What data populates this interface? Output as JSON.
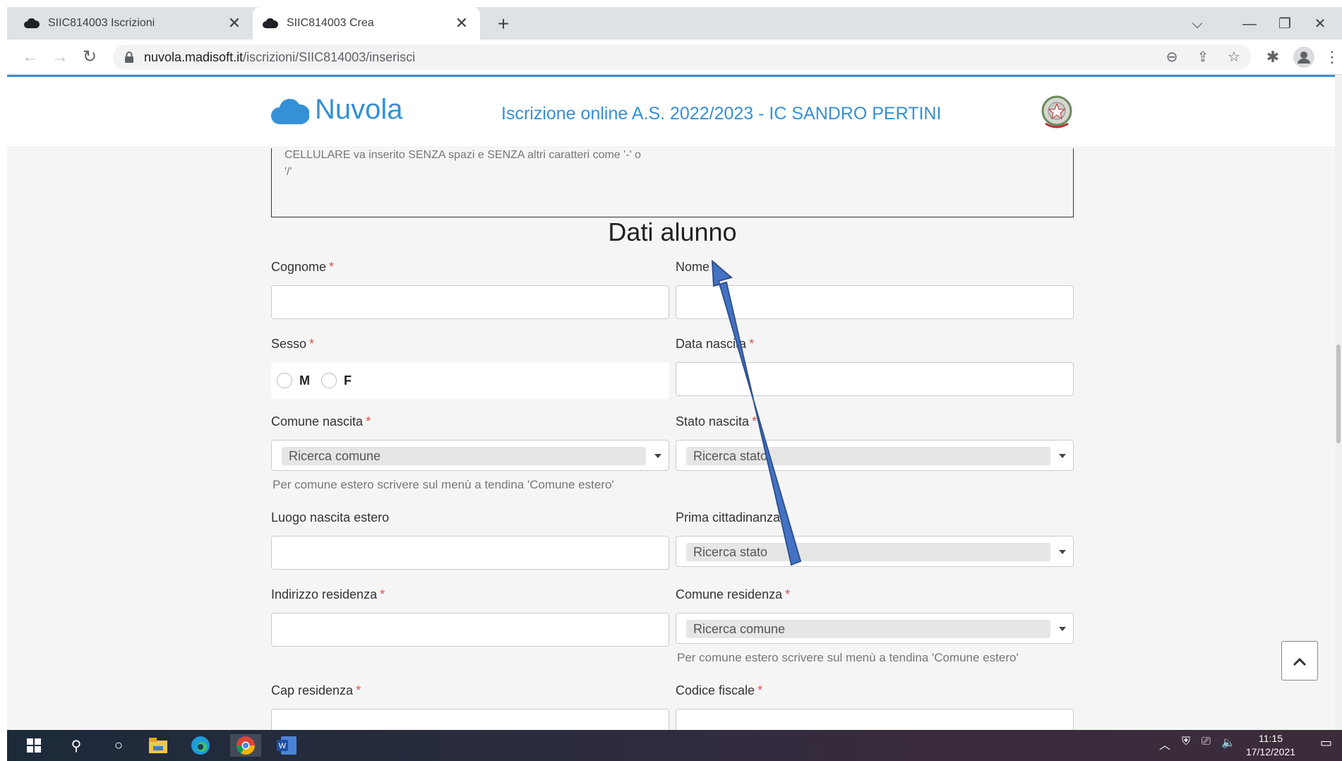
{
  "browser": {
    "tabs": [
      {
        "title": "SIIC814003 Iscrizioni",
        "close": "✕"
      },
      {
        "title": "SIIC814003 Crea",
        "close": "✕"
      }
    ],
    "new_tab": "+",
    "window_controls": {
      "dropdown": "⌵",
      "minimize": "—",
      "restore": "❐",
      "close": "✕"
    },
    "url_host": "nuvola.madisoft.it",
    "url_path": "/iscrizioni/SIIC814003/inserisci"
  },
  "site": {
    "logo_text": "Nuvola",
    "header_title": "Iscrizione online A.S. 2022/2023 - IC SANDRO PERTINI"
  },
  "notice": {
    "line1": "CELLULARE va inserito SENZA spazi e SENZA altri caratteri come '-' o",
    "line2": "'/'"
  },
  "section_title": "Dati alunno",
  "required_mark": "*",
  "fields": {
    "cognome": {
      "label": "Cognome"
    },
    "nome": {
      "label": "Nome"
    },
    "sesso": {
      "label": "Sesso",
      "options": [
        "M",
        "F"
      ]
    },
    "data_nascita": {
      "label": "Data nascita"
    },
    "comune_nascita": {
      "label": "Comune nascita",
      "placeholder": "Ricerca comune",
      "help": "Per comune estero scrivere sul menù a tendina 'Comune estero'"
    },
    "stato_nascita": {
      "label": "Stato nascita",
      "placeholder": "Ricerca stato"
    },
    "luogo_nascita_estero": {
      "label": "Luogo nascita estero"
    },
    "prima_cittadinanza": {
      "label": "Prima cittadinanza",
      "placeholder": "Ricerca stato"
    },
    "indirizzo_residenza": {
      "label": "Indirizzo residenza"
    },
    "comune_residenza": {
      "label": "Comune residenza",
      "placeholder": "Ricerca comune",
      "help": "Per comune estero scrivere sul menù a tendina 'Comune estero'"
    },
    "cap_residenza": {
      "label": "Cap residenza"
    },
    "codice_fiscale": {
      "label": "Codice fiscale"
    }
  },
  "scroll_top_icon": "chevron-up-icon",
  "annotation_color": "#4472c4",
  "taskbar": {
    "time": "11:15",
    "date": "17/12/2021"
  }
}
